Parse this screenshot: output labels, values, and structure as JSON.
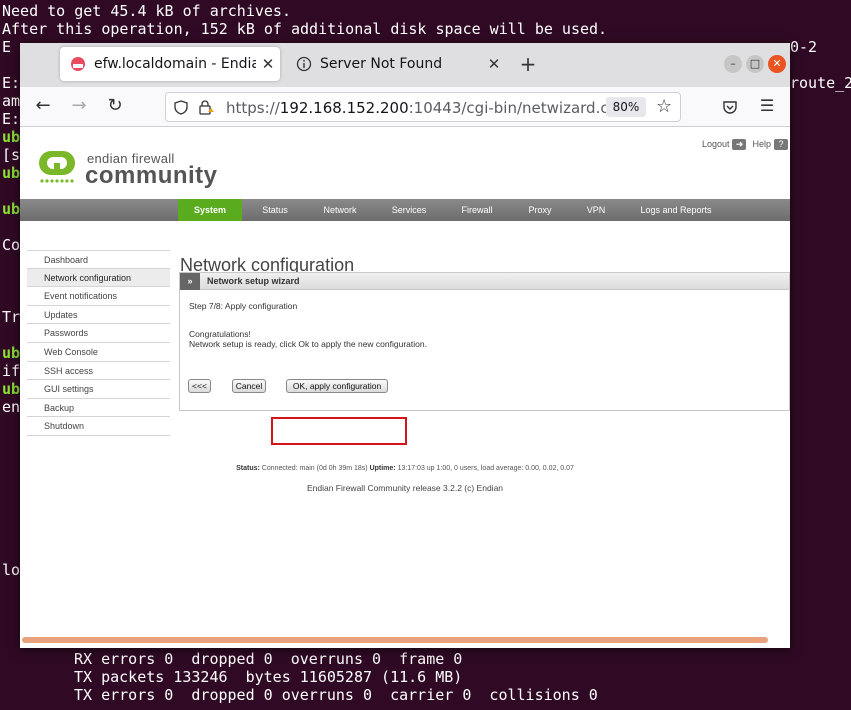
{
  "terminal": {
    "lines_top": [
      "Need to get 45.4 kB of archives.",
      "After this operation, 152 kB of additional disk space will be used.",
      "E"
    ],
    "side_fragments": [
      "E:",
      "am",
      "E:",
      "ub",
      "[s",
      "ub",
      "ub",
      "Co",
      "Tr",
      "ub",
      "if",
      "ub",
      "en",
      "lo"
    ],
    "right_fragments": [
      "0-2",
      "route_2"
    ],
    "lines_bottom": [
      "RX errors 0  dropped 0  overruns 0  frame 0",
      "TX packets 133246  bytes 11605287 (11.6 MB)",
      "TX errors 0  dropped 0 overruns 0  carrier 0  collisions 0"
    ]
  },
  "browser": {
    "tabs": [
      {
        "title": "efw.localdomain - Endian",
        "close": "✕",
        "favicon": "endian-favicon"
      },
      {
        "title": "Server Not Found",
        "close": "✕",
        "favicon": "info-icon"
      }
    ],
    "new_tab": "+",
    "window_controls": {
      "minimize": "–",
      "maximize": "□",
      "close": "✕"
    },
    "nav": {
      "back": "←",
      "forward": "→",
      "reload": "↻"
    },
    "url": {
      "scheme": "https://",
      "host": "192.168.152.200",
      "rest": ":10443/cgi-bin/netwizard.cgi"
    },
    "zoom": "80%",
    "bookmark_icon": "☆",
    "pocket_icon": "pocket-icon",
    "menu_icon": "☰"
  },
  "page": {
    "logo": {
      "line1": "endian firewall",
      "line2": "community"
    },
    "toplinks": {
      "logout": "Logout",
      "help": "Help"
    },
    "menu": [
      {
        "label": "System",
        "active": true
      },
      {
        "label": "Status",
        "active": false
      },
      {
        "label": "Network",
        "active": false
      },
      {
        "label": "Services",
        "active": false
      },
      {
        "label": "Firewall",
        "active": false
      },
      {
        "label": "Proxy",
        "active": false
      },
      {
        "label": "VPN",
        "active": false
      },
      {
        "label": "Logs and Reports",
        "active": false
      }
    ],
    "sidebar": [
      {
        "label": "Dashboard",
        "active": false
      },
      {
        "label": "Network configuration",
        "active": true
      },
      {
        "label": "Event notifications",
        "active": false
      },
      {
        "label": "Updates",
        "active": false
      },
      {
        "label": "Passwords",
        "active": false
      },
      {
        "label": "Web Console",
        "active": false
      },
      {
        "label": "SSH access",
        "active": false
      },
      {
        "label": "GUI settings",
        "active": false
      },
      {
        "label": "Backup",
        "active": false
      },
      {
        "label": "Shutdown",
        "active": false
      }
    ],
    "title": "Network configuration",
    "wizard": {
      "header_arrow": "»",
      "header": "Network setup wizard",
      "step": "Step 7/8: Apply configuration",
      "congrats": "Congratulations!",
      "message": "Network setup is ready, click Ok to apply the new configuration.",
      "back_button": "<<<",
      "cancel_button": "Cancel",
      "ok_button": "OK, apply configuration"
    },
    "status": {
      "status_label": "Status:",
      "status_value": "Connected: main (0d 0h 39m 18s)",
      "uptime_label": "Uptime:",
      "uptime_value": "13:17:03 up 1:00, 0 users, load average: 0.00, 0.02, 0.07"
    },
    "release": "Endian Firewall Community release 3.2.2 (c) Endian"
  }
}
